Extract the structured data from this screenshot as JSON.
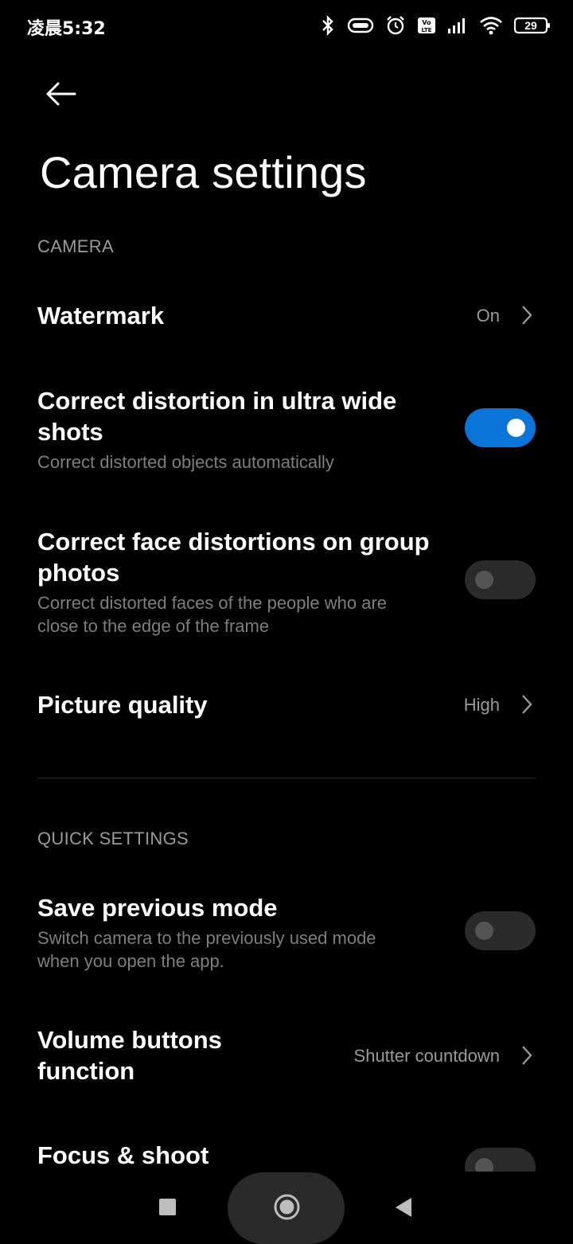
{
  "status_bar": {
    "time": "凌晨5:32",
    "battery": "29",
    "icons": [
      "bluetooth-icon",
      "vibrate-icon",
      "alarm-icon",
      "volte-icon",
      "signal-icon",
      "wifi-icon",
      "battery-icon"
    ]
  },
  "header": {
    "back_icon": "back-arrow-icon",
    "title": "Camera settings"
  },
  "sections": {
    "camera": {
      "title": "CAMERA",
      "watermark": {
        "label": "Watermark",
        "value": "On"
      },
      "ultra_wide": {
        "label_line1": "Correct distortion in ultra wide",
        "label_line2": "shots",
        "description": "Correct distorted objects automatically",
        "enabled": true
      },
      "face_distortion": {
        "label_line1": "Correct face distortions on group",
        "label_line2": "photos",
        "description_line1": "Correct distorted faces of the people who are",
        "description_line2": "close to the edge of the frame",
        "enabled": false
      },
      "picture_quality": {
        "label": "Picture quality",
        "value": "High"
      }
    },
    "quick_settings": {
      "title": "QUICK SETTINGS",
      "save_previous_mode": {
        "label": "Save previous mode",
        "description_line1": "Switch camera to the previously used mode",
        "description_line2": "when you open the app.",
        "enabled": false
      },
      "volume_buttons": {
        "label_line1": "Volume buttons",
        "label_line2": "function",
        "value": "Shutter countdown"
      },
      "focus_shoot": {
        "label": "Focus & shoot",
        "enabled": false
      }
    }
  },
  "nav_bar": {
    "icons": [
      "recents-square-icon",
      "home-circle-icon",
      "back-triangle-icon"
    ]
  },
  "colors": {
    "background": "#000000",
    "accent": "#0a74d9",
    "secondary_text": "#9a9a9a"
  }
}
